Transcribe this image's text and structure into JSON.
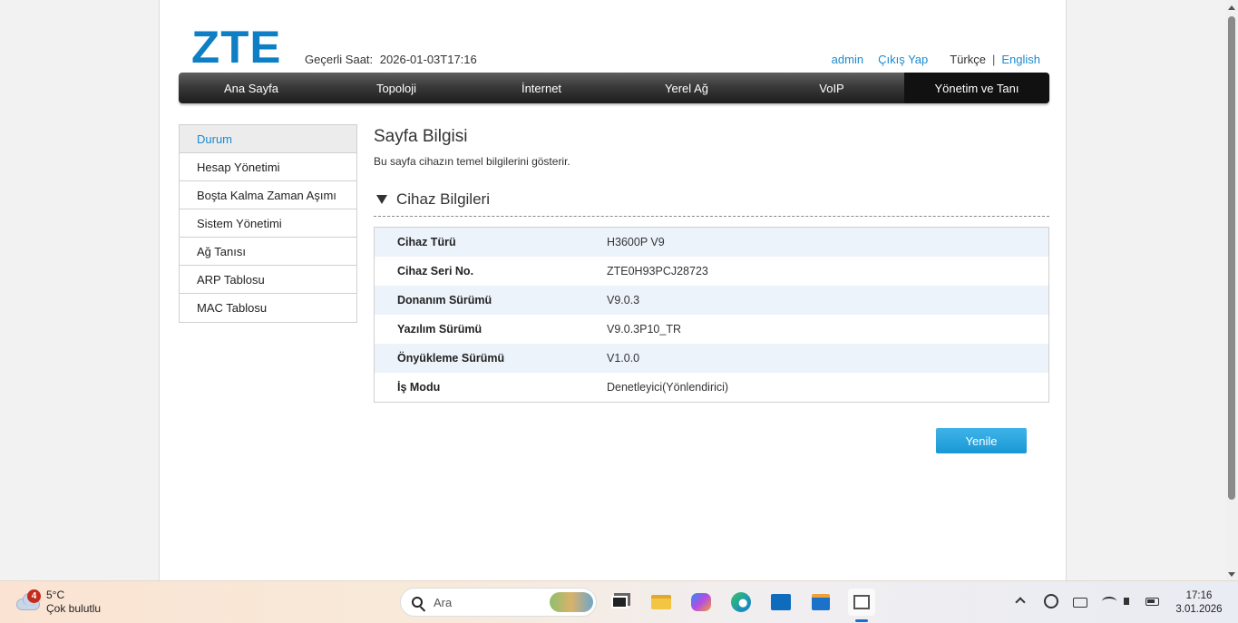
{
  "header": {
    "logo_text": "ZTE",
    "clock_label": "Geçerli Saat:",
    "clock_value": "2026-01-03T17:16",
    "user": "admin",
    "logout": "Çıkış Yap",
    "lang_current": "Türkçe",
    "lang_sep": "|",
    "lang_other": "English"
  },
  "nav": {
    "items": [
      {
        "label": "Ana Sayfa"
      },
      {
        "label": "Topoloji"
      },
      {
        "label": "İnternet"
      },
      {
        "label": "Yerel Ağ"
      },
      {
        "label": "VoIP"
      },
      {
        "label": "Yönetim ve Tanı"
      }
    ],
    "active": "Yönetim ve Tanı"
  },
  "sidebar": {
    "items": [
      {
        "label": "Durum"
      },
      {
        "label": "Hesap Yönetimi"
      },
      {
        "label": "Boşta Kalma Zaman Aşımı"
      },
      {
        "label": "Sistem Yönetimi"
      },
      {
        "label": "Ağ Tanısı"
      },
      {
        "label": "ARP Tablosu"
      },
      {
        "label": "MAC Tablosu"
      }
    ],
    "active": "Durum"
  },
  "content": {
    "title": "Sayfa Bilgisi",
    "description": "Bu sayfa cihazın temel bilgilerini gösterir.",
    "section_title": "Cihaz Bilgileri",
    "rows": [
      {
        "label": "Cihaz Türü",
        "value": "H3600P V9"
      },
      {
        "label": "Cihaz Seri No.",
        "value": "ZTE0H93PCJ28723"
      },
      {
        "label": "Donanım Sürümü",
        "value": "V9.0.3"
      },
      {
        "label": "Yazılım Sürümü",
        "value": "V9.0.3P10_TR"
      },
      {
        "label": "Önyükleme Sürümü",
        "value": "V1.0.0"
      },
      {
        "label": "İş Modu",
        "value": "Denetleyici(Yönlendirici)"
      }
    ],
    "refresh_label": "Yenile"
  },
  "taskbar": {
    "weather_badge": "4",
    "weather_temp": "5°C",
    "weather_desc": "Çok bulutlu",
    "search_placeholder": "Ara",
    "time": "17:16",
    "date": "3.01.2026"
  },
  "colors": {
    "brand": "#0e7fc4",
    "link": "#1a8bd0",
    "button": "#1998d5",
    "row_alt": "#edf3fb"
  }
}
